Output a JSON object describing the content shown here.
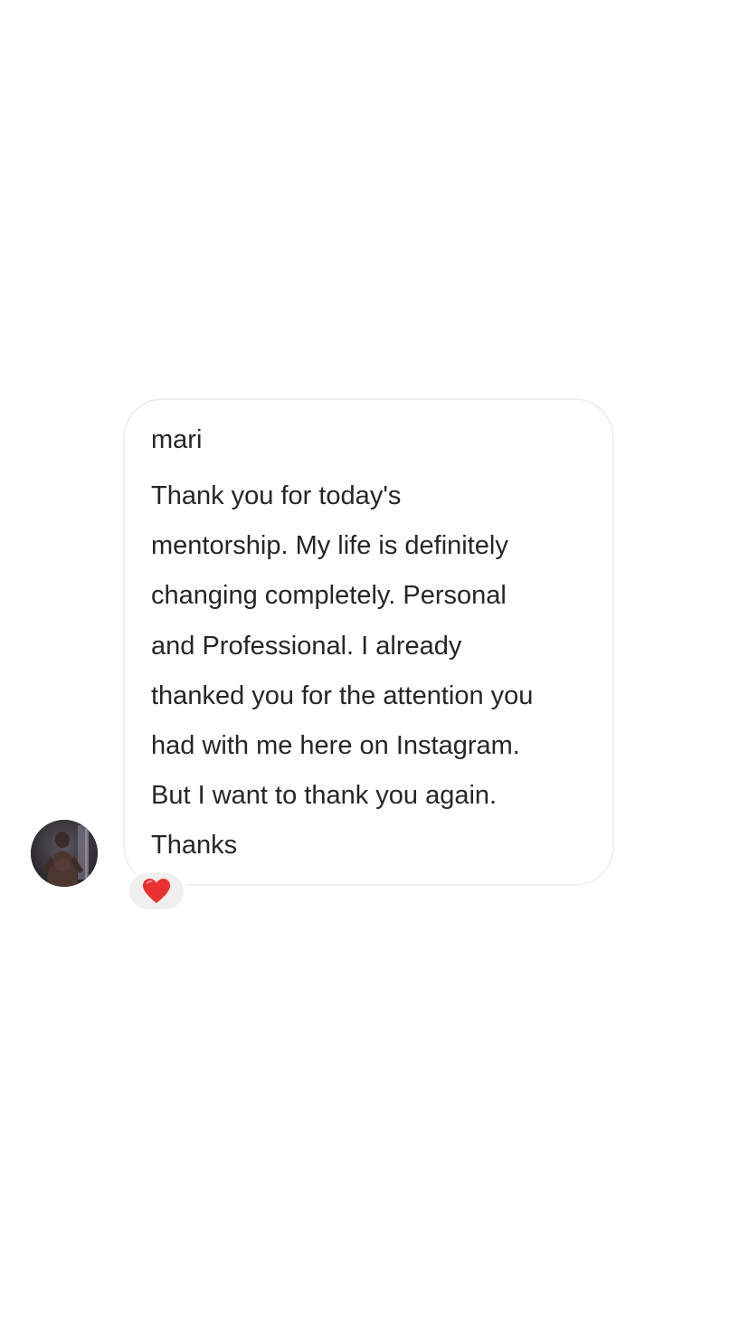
{
  "message": {
    "sender_name": "mari",
    "lines": [
      "Thank you for today's",
      "mentorship. My life is definitely",
      "changing completely. Personal",
      "and Professional. I already",
      "thanked you for the attention you",
      "had with me here on Instagram.",
      "But I want to thank you again.",
      "Thanks"
    ],
    "reaction_icon": "red-heart-icon",
    "avatar_icon": "profile-photo"
  },
  "colors": {
    "background": "#ffffff",
    "bubble_border": "#efefef",
    "text": "#262626",
    "reaction_background": "#efefef",
    "heart": "#e8322f"
  }
}
